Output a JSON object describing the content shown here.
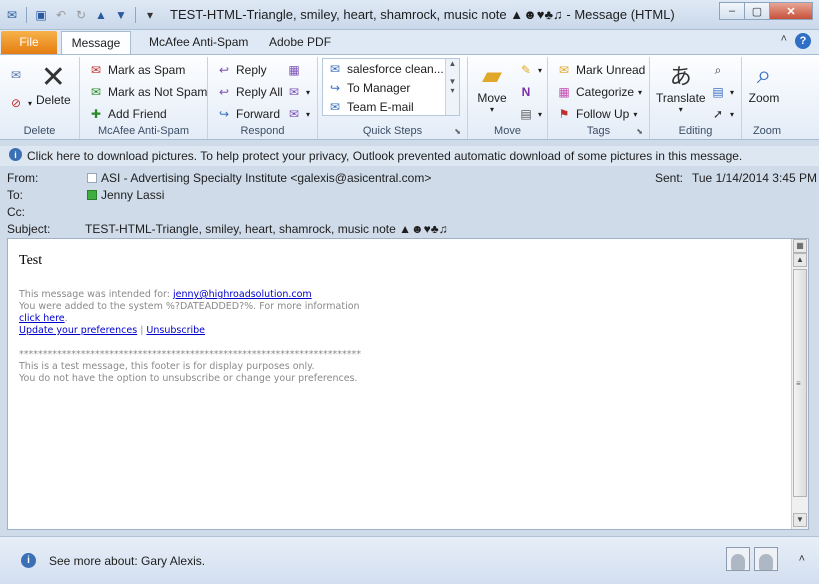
{
  "window": {
    "title": "TEST-HTML-Triangle, smiley, heart, shamrock, music note ▲☻♥♣♫  - Message (HTML)",
    "controls": [
      "–",
      "▢",
      "✕"
    ]
  },
  "tabs": [
    "File",
    "Message",
    "McAfee Anti-Spam",
    "Adobe PDF"
  ],
  "ribbon": {
    "delete": {
      "label": "Delete",
      "group": "Delete"
    },
    "mcafee": {
      "mark_spam": "Mark as Spam",
      "mark_not_spam": "Mark as Not Spam",
      "add_friend": "Add Friend",
      "group": "McAfee Anti-Spam"
    },
    "respond": {
      "reply": "Reply",
      "reply_all": "Reply All",
      "forward": "Forward",
      "group": "Respond"
    },
    "quicksteps": {
      "items": [
        "salesforce clean...",
        "To Manager",
        "Team E-mail"
      ],
      "group": "Quick Steps"
    },
    "move": {
      "label": "Move",
      "group": "Move"
    },
    "tags": {
      "mark_unread": "Mark Unread",
      "categorize": "Categorize",
      "follow_up": "Follow Up",
      "group": "Tags"
    },
    "editing": {
      "translate": "Translate",
      "group": "Editing"
    },
    "zoom": {
      "label": "Zoom",
      "group": "Zoom"
    }
  },
  "infobar": "Click here to download pictures. To help protect your privacy, Outlook prevented automatic download of some pictures in this message.",
  "header": {
    "from_label": "From:",
    "from_value": "ASI - Advertising Specialty Institute <galexis@asicentral.com>",
    "sent_label": "Sent:",
    "sent_value": "Tue 1/14/2014 3:45 PM",
    "to_label": "To:",
    "to_value": "Jenny Lassi",
    "cc_label": "Cc:",
    "subject_label": "Subject:",
    "subject_value": "TEST-HTML-Triangle, smiley, heart, shamrock, music note ▲☻♥♣♫"
  },
  "body": {
    "heading": "Test",
    "intended_prefix": "This message was intended for: ",
    "intended_email": "jenny@highroadsolution.com",
    "added_line": "You were added to the system %?DATEADDED?%. For more information",
    "click_here": "click here",
    "update_prefs": "Update your preferences",
    "pipe": "|",
    "unsubscribe": "Unsubscribe",
    "stars": "************************************************************************",
    "footer1": "This is a test message, this footer is for display purposes only.",
    "footer2": "You do not have the option to unsubscribe or change your preferences."
  },
  "bottom": {
    "see_more": "See more about: Gary Alexis."
  }
}
